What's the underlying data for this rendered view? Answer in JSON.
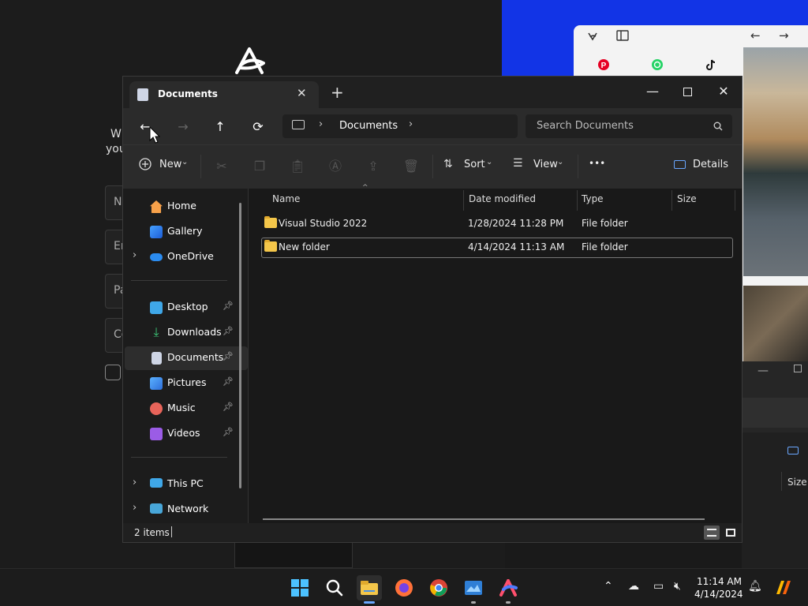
{
  "background_app": {
    "fields": [
      "N",
      "Er",
      "Pa",
      "Co"
    ],
    "text_lines": [
      "W",
      "you"
    ]
  },
  "browser": {
    "icons": [
      "pinterest-icon",
      "whatsapp-icon",
      "tiktok-icon"
    ]
  },
  "behind_window": {
    "col_label": "Size"
  },
  "explorer": {
    "tab_title": "Documents",
    "address": {
      "segments": [
        "Documents"
      ]
    },
    "search_placeholder": "Search Documents",
    "toolbar": {
      "new_label": "New",
      "sort_label": "Sort",
      "view_label": "View",
      "more_label": "•••",
      "details_label": "Details"
    },
    "sidebar": {
      "top_items": [
        {
          "label": "Home",
          "icon": "home-icon"
        },
        {
          "label": "Gallery",
          "icon": "gallery-icon"
        },
        {
          "label": "OneDrive",
          "icon": "onedrive-icon"
        }
      ],
      "pinned_items": [
        {
          "label": "Desktop",
          "icon": "desktop-icon"
        },
        {
          "label": "Downloads",
          "icon": "downloads-icon"
        },
        {
          "label": "Documents",
          "icon": "documents-icon"
        },
        {
          "label": "Pictures",
          "icon": "pictures-icon"
        },
        {
          "label": "Music",
          "icon": "music-icon"
        },
        {
          "label": "Videos",
          "icon": "videos-icon"
        }
      ],
      "bottom_items": [
        {
          "label": "This PC",
          "icon": "this-pc-icon"
        },
        {
          "label": "Network",
          "icon": "network-icon"
        }
      ]
    },
    "columns": [
      "Name",
      "Date modified",
      "Type",
      "Size"
    ],
    "rows": [
      {
        "name": "Visual Studio 2022",
        "date": "1/28/2024 11:28 PM",
        "type": "File folder",
        "size": ""
      },
      {
        "name": "New folder",
        "date": "4/14/2024 11:13 AM",
        "type": "File folder",
        "size": ""
      }
    ],
    "status": "2 items"
  },
  "taskbar": {
    "apps": [
      "windows-start-icon",
      "search-icon",
      "file-explorer-icon",
      "firefox-icon",
      "chrome-icon",
      "app-icon",
      "arc-icon"
    ],
    "clock_time": "11:14 AM",
    "clock_date": "4/14/2024"
  },
  "colors": {
    "explorer_bg": "#191919",
    "toolbar_bg": "#2b2b2b",
    "folder": "#f4c64a",
    "accent_blue": "#1234e6"
  }
}
